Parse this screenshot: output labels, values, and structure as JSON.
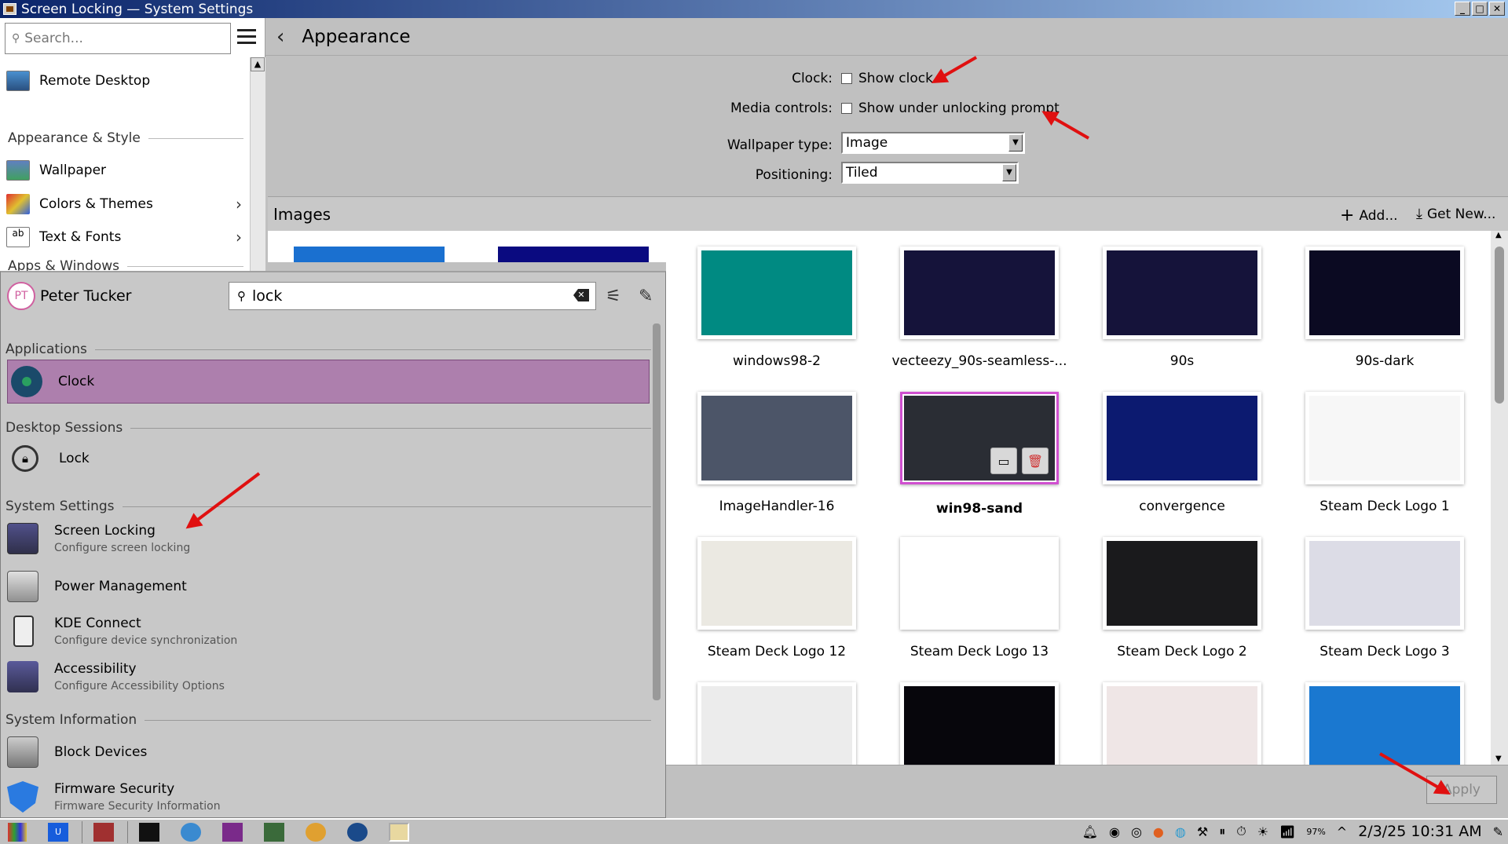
{
  "window": {
    "title": "Screen Locking — System Settings",
    "buttons": [
      "_",
      "□",
      "✕"
    ]
  },
  "sidebar": {
    "search_placeholder": "Search...",
    "items": {
      "remote_desktop": "Remote Desktop",
      "appearance_style": "Appearance & Style",
      "wallpaper": "Wallpaper",
      "colors_themes": "Colors & Themes",
      "text_fonts": "Text & Fonts",
      "apps_windows": "Apps & Windows"
    }
  },
  "header": {
    "title": "Appearance"
  },
  "form": {
    "clock_label": "Clock:",
    "clock_checkbox": "Show clock",
    "clock_checked": false,
    "media_label": "Media controls:",
    "media_checkbox": "Show under unlocking prompt",
    "media_checked": false,
    "wallpaper_type_label": "Wallpaper type:",
    "wallpaper_type_value": "Image",
    "positioning_label": "Positioning:",
    "positioning_value": "Tiled"
  },
  "images_bar": {
    "label": "Images",
    "add": "Add...",
    "get_new": "Get New..."
  },
  "wallpapers": [
    {
      "name": "windows98-2",
      "color": "#008a82"
    },
    {
      "name": "vecteezy_90s-seamless-...",
      "color": "#15133a"
    },
    {
      "name": "90s",
      "color": "#15133a"
    },
    {
      "name": "90s-dark",
      "color": "#0b0a22"
    },
    {
      "name": "ImageHandler-16",
      "color": "#4c5568"
    },
    {
      "name": "win98-sand",
      "color": "#2a2d34",
      "selected": true
    },
    {
      "name": "convergence",
      "color": "#0c1a70"
    },
    {
      "name": "Steam Deck Logo 1",
      "color": "#f7f7f7"
    },
    {
      "name": "Steam Deck Logo 12",
      "color": "#ebe9e2"
    },
    {
      "name": "Steam Deck Logo 13",
      "color": "#ffffff"
    },
    {
      "name": "Steam Deck Logo 2",
      "color": "#1a1a1c"
    },
    {
      "name": "Steam Deck Logo 3",
      "color": "#dcdce6"
    },
    {
      "name": "",
      "color": "#ececec"
    },
    {
      "name": "",
      "color": "#07060c"
    },
    {
      "name": "",
      "color": "#efe6e6"
    },
    {
      "name": "",
      "color": "#1a78d0"
    }
  ],
  "bottom": {
    "apply": "Apply"
  },
  "launcher": {
    "user": {
      "initials": "PT",
      "name": "Peter Tucker"
    },
    "search_value": "lock",
    "sections": {
      "applications": "Applications",
      "desktop_sessions": "Desktop Sessions",
      "system_settings": "System Settings",
      "system_information": "System Information"
    },
    "items": {
      "clock": {
        "title": "Clock"
      },
      "lock": {
        "title": "Lock"
      },
      "screen_locking": {
        "title": "Screen Locking",
        "subtitle": "Configure screen locking"
      },
      "power": {
        "title": "Power Management"
      },
      "kde_connect": {
        "title": "KDE Connect",
        "subtitle": "Configure device synchronization"
      },
      "accessibility": {
        "title": "Accessibility",
        "subtitle": "Configure Accessibility Options"
      },
      "block_devices": {
        "title": "Block Devices"
      },
      "firmware": {
        "title": "Firmware Security",
        "subtitle": "Firmware Security Information"
      }
    }
  },
  "taskbar": {
    "clock": "2/3/25 10:31 AM",
    "battery": "97%"
  },
  "colors": {
    "accent": "#ad7fad",
    "annotation": "#e01010",
    "selection_border": "#d050d0"
  }
}
